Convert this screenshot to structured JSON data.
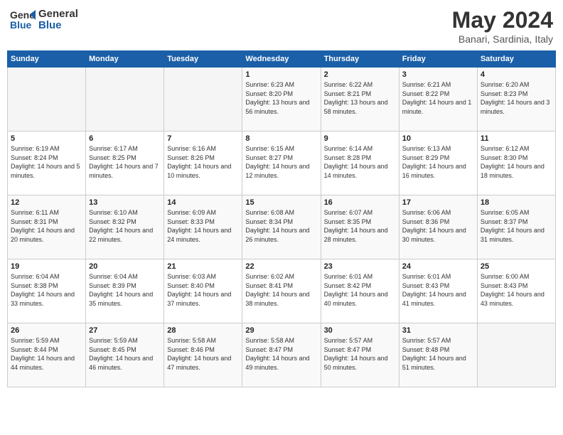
{
  "header": {
    "logo_line1": "General",
    "logo_line2": "Blue",
    "month_year": "May 2024",
    "location": "Banari, Sardinia, Italy"
  },
  "weekdays": [
    "Sunday",
    "Monday",
    "Tuesday",
    "Wednesday",
    "Thursday",
    "Friday",
    "Saturday"
  ],
  "weeks": [
    [
      {
        "day": "",
        "info": ""
      },
      {
        "day": "",
        "info": ""
      },
      {
        "day": "",
        "info": ""
      },
      {
        "day": "1",
        "info": "Sunrise: 6:23 AM\nSunset: 8:20 PM\nDaylight: 13 hours and 56 minutes."
      },
      {
        "day": "2",
        "info": "Sunrise: 6:22 AM\nSunset: 8:21 PM\nDaylight: 13 hours and 58 minutes."
      },
      {
        "day": "3",
        "info": "Sunrise: 6:21 AM\nSunset: 8:22 PM\nDaylight: 14 hours and 1 minute."
      },
      {
        "day": "4",
        "info": "Sunrise: 6:20 AM\nSunset: 8:23 PM\nDaylight: 14 hours and 3 minutes."
      }
    ],
    [
      {
        "day": "5",
        "info": "Sunrise: 6:19 AM\nSunset: 8:24 PM\nDaylight: 14 hours and 5 minutes."
      },
      {
        "day": "6",
        "info": "Sunrise: 6:17 AM\nSunset: 8:25 PM\nDaylight: 14 hours and 7 minutes."
      },
      {
        "day": "7",
        "info": "Sunrise: 6:16 AM\nSunset: 8:26 PM\nDaylight: 14 hours and 10 minutes."
      },
      {
        "day": "8",
        "info": "Sunrise: 6:15 AM\nSunset: 8:27 PM\nDaylight: 14 hours and 12 minutes."
      },
      {
        "day": "9",
        "info": "Sunrise: 6:14 AM\nSunset: 8:28 PM\nDaylight: 14 hours and 14 minutes."
      },
      {
        "day": "10",
        "info": "Sunrise: 6:13 AM\nSunset: 8:29 PM\nDaylight: 14 hours and 16 minutes."
      },
      {
        "day": "11",
        "info": "Sunrise: 6:12 AM\nSunset: 8:30 PM\nDaylight: 14 hours and 18 minutes."
      }
    ],
    [
      {
        "day": "12",
        "info": "Sunrise: 6:11 AM\nSunset: 8:31 PM\nDaylight: 14 hours and 20 minutes."
      },
      {
        "day": "13",
        "info": "Sunrise: 6:10 AM\nSunset: 8:32 PM\nDaylight: 14 hours and 22 minutes."
      },
      {
        "day": "14",
        "info": "Sunrise: 6:09 AM\nSunset: 8:33 PM\nDaylight: 14 hours and 24 minutes."
      },
      {
        "day": "15",
        "info": "Sunrise: 6:08 AM\nSunset: 8:34 PM\nDaylight: 14 hours and 26 minutes."
      },
      {
        "day": "16",
        "info": "Sunrise: 6:07 AM\nSunset: 8:35 PM\nDaylight: 14 hours and 28 minutes."
      },
      {
        "day": "17",
        "info": "Sunrise: 6:06 AM\nSunset: 8:36 PM\nDaylight: 14 hours and 30 minutes."
      },
      {
        "day": "18",
        "info": "Sunrise: 6:05 AM\nSunset: 8:37 PM\nDaylight: 14 hours and 31 minutes."
      }
    ],
    [
      {
        "day": "19",
        "info": "Sunrise: 6:04 AM\nSunset: 8:38 PM\nDaylight: 14 hours and 33 minutes."
      },
      {
        "day": "20",
        "info": "Sunrise: 6:04 AM\nSunset: 8:39 PM\nDaylight: 14 hours and 35 minutes."
      },
      {
        "day": "21",
        "info": "Sunrise: 6:03 AM\nSunset: 8:40 PM\nDaylight: 14 hours and 37 minutes."
      },
      {
        "day": "22",
        "info": "Sunrise: 6:02 AM\nSunset: 8:41 PM\nDaylight: 14 hours and 38 minutes."
      },
      {
        "day": "23",
        "info": "Sunrise: 6:01 AM\nSunset: 8:42 PM\nDaylight: 14 hours and 40 minutes."
      },
      {
        "day": "24",
        "info": "Sunrise: 6:01 AM\nSunset: 8:43 PM\nDaylight: 14 hours and 41 minutes."
      },
      {
        "day": "25",
        "info": "Sunrise: 6:00 AM\nSunset: 8:43 PM\nDaylight: 14 hours and 43 minutes."
      }
    ],
    [
      {
        "day": "26",
        "info": "Sunrise: 5:59 AM\nSunset: 8:44 PM\nDaylight: 14 hours and 44 minutes."
      },
      {
        "day": "27",
        "info": "Sunrise: 5:59 AM\nSunset: 8:45 PM\nDaylight: 14 hours and 46 minutes."
      },
      {
        "day": "28",
        "info": "Sunrise: 5:58 AM\nSunset: 8:46 PM\nDaylight: 14 hours and 47 minutes."
      },
      {
        "day": "29",
        "info": "Sunrise: 5:58 AM\nSunset: 8:47 PM\nDaylight: 14 hours and 49 minutes."
      },
      {
        "day": "30",
        "info": "Sunrise: 5:57 AM\nSunset: 8:47 PM\nDaylight: 14 hours and 50 minutes."
      },
      {
        "day": "31",
        "info": "Sunrise: 5:57 AM\nSunset: 8:48 PM\nDaylight: 14 hours and 51 minutes."
      },
      {
        "day": "",
        "info": ""
      }
    ]
  ]
}
